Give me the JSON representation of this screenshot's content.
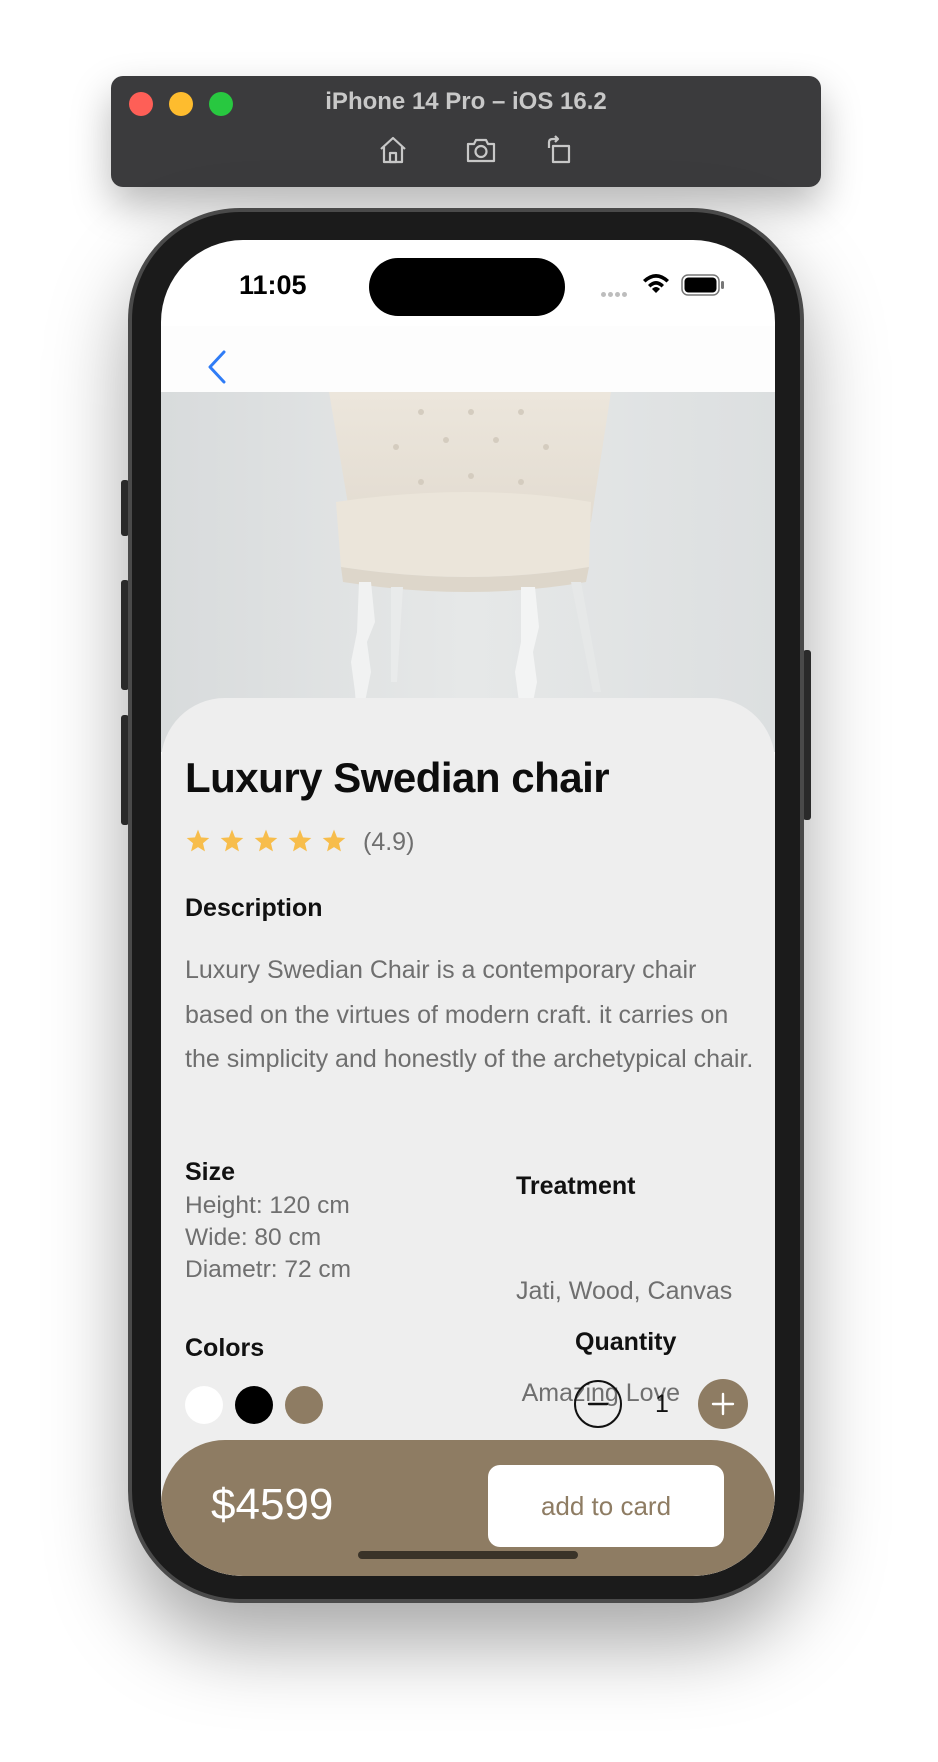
{
  "simulator": {
    "title": "iPhone 14 Pro – iOS 16.2",
    "buttons": [
      "home-icon",
      "screenshot-icon",
      "rotate-icon"
    ]
  },
  "status_bar": {
    "time": "11:05",
    "icons": [
      "cellular-signal-icon",
      "wifi-icon",
      "battery-icon"
    ]
  },
  "nav": {
    "back_icon": "chevron-left-icon",
    "accent_color": "#2f7cf6"
  },
  "product": {
    "title": "Luxury Swedian chair",
    "rating_stars": 5,
    "rating_text": "(4.9)",
    "star_color": "#f7bd4b",
    "description_heading": "Description",
    "description": "Luxury Swedian Chair is a contemporary chair based on the virtues of modern craft. it carries on the simplicity and honestly of the archetypical chair.",
    "size": {
      "heading": "Size",
      "height": "Height: 120 cm",
      "wide": "Wide: 80 cm",
      "diameter": "Diametr: 72 cm"
    },
    "treatment": {
      "heading": "Treatment",
      "line1": "Jati, Wood, Canvas",
      "line2": " Amazing Love"
    },
    "colors": {
      "heading": "Colors",
      "swatches": [
        "#ffffff",
        "#000000",
        "#8e7c63"
      ]
    },
    "quantity": {
      "heading": "Quantity",
      "value": "1"
    }
  },
  "footer": {
    "price": "$4599",
    "button_label": "add to card",
    "brand_color": "#8e7c63"
  }
}
